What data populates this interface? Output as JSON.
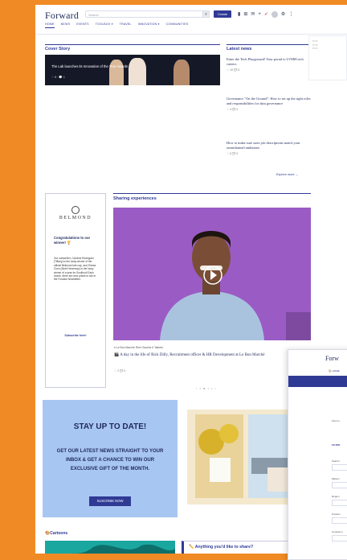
{
  "header": {
    "logo": "Forward",
    "search_placeholder": "Search",
    "create_label": "Create",
    "nav": [
      "HOME",
      "NEWS",
      "EVENTS",
      "TOOLBOX ▾",
      "TRAVEL",
      "INNOVATION ▾",
      "COMMUNITIES"
    ]
  },
  "cover": {
    "heading": "Cover Story",
    "title": "The Lab launches its Innovation of the Year Awards",
    "meta": "♡ 8 · 💬 1"
  },
  "news": {
    "heading": "Latest news",
    "items": [
      {
        "title": "Enter the Tech Playground! Your portal to LVMH tech careers",
        "meta": "♡ 19  💬 0"
      },
      {
        "title": "Governance \"On the Ground\": How to set up the right roles and responsibilities for data governance",
        "meta": "♡ 4  💬 0"
      },
      {
        "title": "How to make sure sizes job descriptions match your omnichannel ambitions",
        "meta": "♡ 5  💬 0"
      }
    ],
    "explore": "Explore more →"
  },
  "ad": {
    "brand": "BELMOND",
    "congrats": "Congratulations to our winner! 🏆",
    "body": "Our subscriber, Caroline Rodriguez (Tiffany) is the lucky winner of the official Belmond tote cap, and Teresa Chen (Moët Hennessy) is the lucky winner of a year for Soulfood! Each month, there are new prizes to win in the Forward Newsletter.",
    "subscribe": "Subscribe here!"
  },
  "video": {
    "heading": "Sharing experiences",
    "tags": "# Le Bon Marché Rive Gauche  # Talents",
    "title": "🎬 A day in the life of Rick Dilly, Recruitment officer & HR Development at Le Bon Marché",
    "meta": "♡ 2  💬 0",
    "dots": "‹ • ● • • ›"
  },
  "promo": {
    "heading": "STAY UP TO DATE!",
    "text": "GET OUR LATEST NEWS STRAIGHT TO YOUR INBOX & GET A CHANCE TO WIN OUR EXCLUSIVE GIFT OF THE MONTH.",
    "button": "SUSCRIBE NOW"
  },
  "bottom": {
    "cartoons": "🎨Cartoons",
    "share": "✏️ Anything you'd like to share?"
  },
  "filter": {
    "logo": "Forw",
    "home": "🏠 HOME",
    "find": "Find yo",
    "filter_label": "FILTER",
    "fields": [
      "Search",
      "Maison",
      "Region",
      "Position",
      "Contract p"
    ]
  },
  "colors": {
    "accent": "#2f3a95",
    "page_bg": "#f08a24",
    "promo_bg": "#a8c6f2",
    "video_bg": "#9b5bc5"
  }
}
